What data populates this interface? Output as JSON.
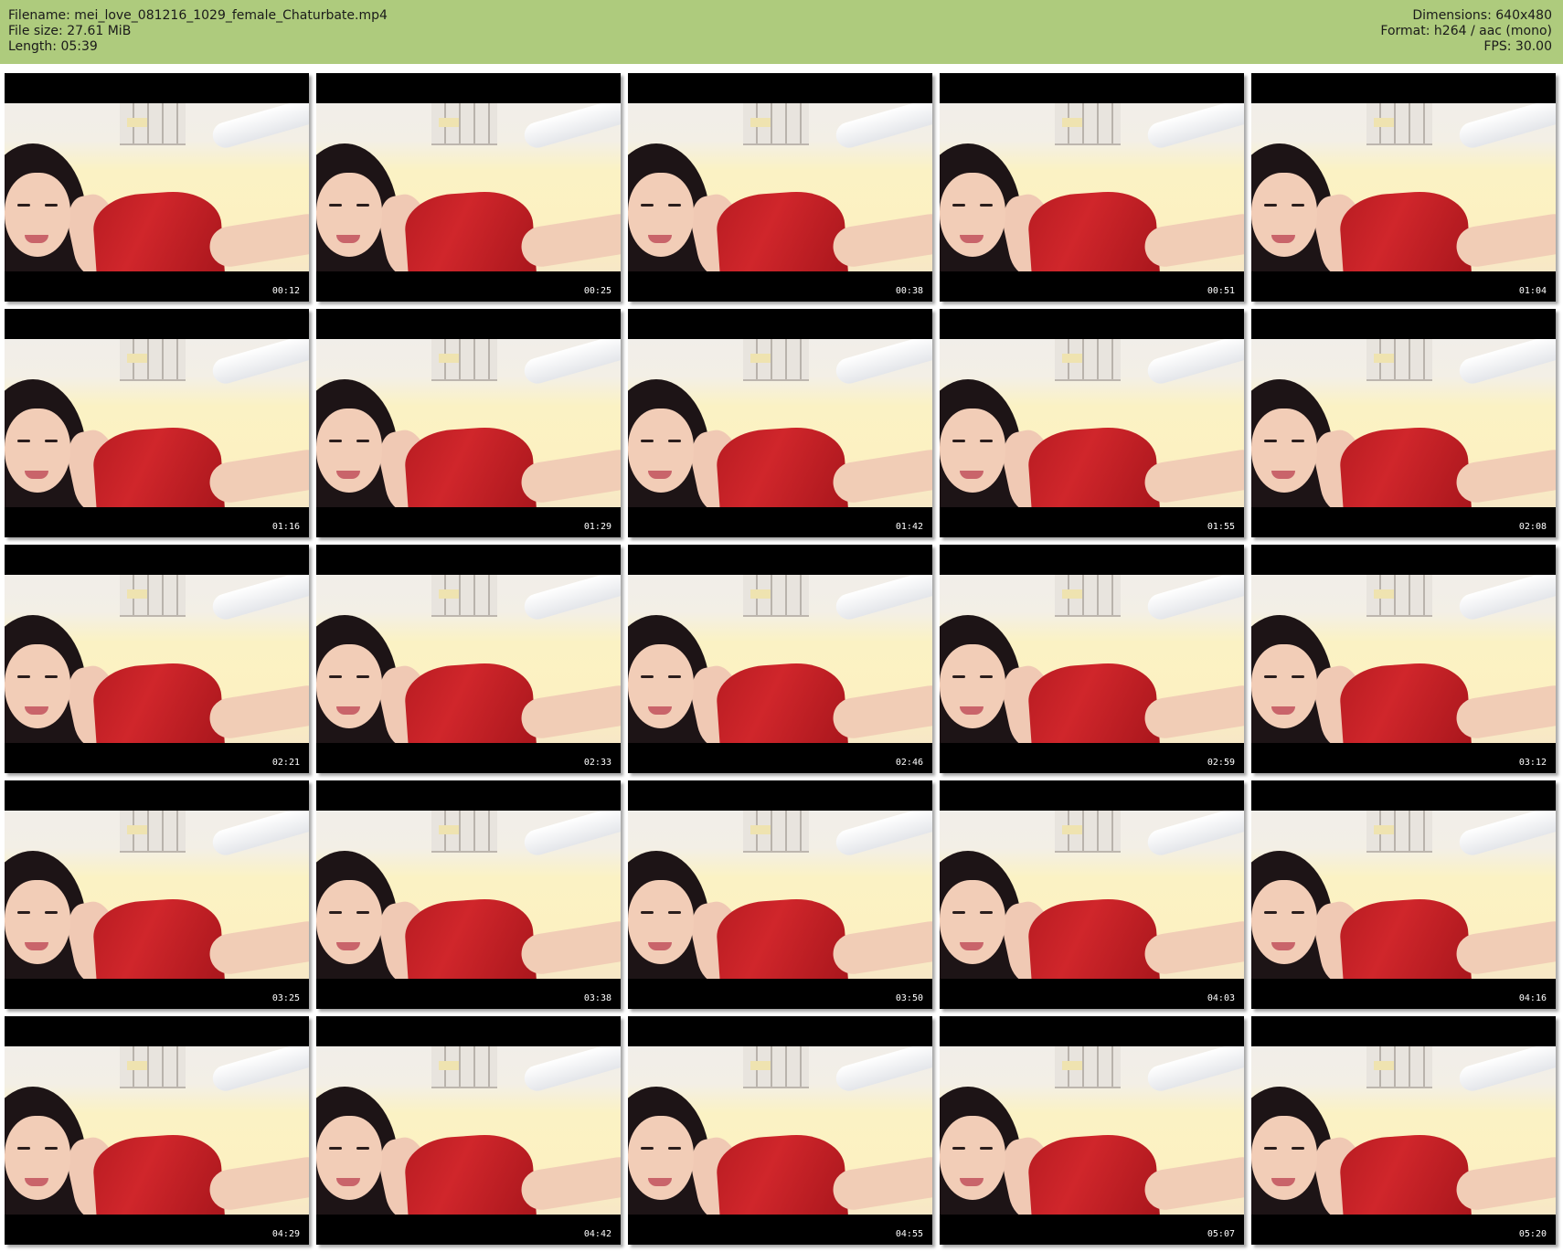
{
  "header": {
    "filename": "Filename: mei_love_081216_1029_female_Chaturbate.mp4",
    "filesize": "File size: 27.61 MiB",
    "length": "Length: 05:39",
    "dimensions": "Dimensions: 640x480",
    "format": "Format: h264 / aac (mono)",
    "fps": "FPS: 30.00"
  },
  "thumbnails": [
    {
      "timestamp": "00:12"
    },
    {
      "timestamp": "00:25"
    },
    {
      "timestamp": "00:38"
    },
    {
      "timestamp": "00:51"
    },
    {
      "timestamp": "01:04"
    },
    {
      "timestamp": "01:16"
    },
    {
      "timestamp": "01:29"
    },
    {
      "timestamp": "01:42"
    },
    {
      "timestamp": "01:55"
    },
    {
      "timestamp": "02:08"
    },
    {
      "timestamp": "02:21"
    },
    {
      "timestamp": "02:33"
    },
    {
      "timestamp": "02:46"
    },
    {
      "timestamp": "02:59"
    },
    {
      "timestamp": "03:12"
    },
    {
      "timestamp": "03:25"
    },
    {
      "timestamp": "03:38"
    },
    {
      "timestamp": "03:50"
    },
    {
      "timestamp": "04:03"
    },
    {
      "timestamp": "04:16"
    },
    {
      "timestamp": "04:29"
    },
    {
      "timestamp": "04:42"
    },
    {
      "timestamp": "04:55"
    },
    {
      "timestamp": "05:07"
    },
    {
      "timestamp": "05:20"
    }
  ]
}
